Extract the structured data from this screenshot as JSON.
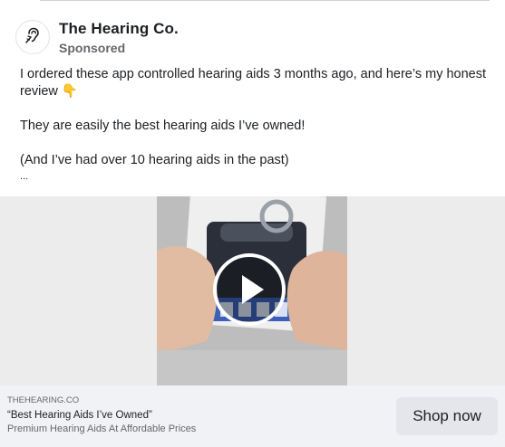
{
  "post": {
    "page_name": "The Hearing Co.",
    "sponsored_label": "Sponsored",
    "text": {
      "line1": "I ordered these app controlled hearing aids 3 months ago, and here’s my honest review 👇",
      "line2": "They are easily the best hearing aids I’ve owned!",
      "line3": "(And I’ve had over 10 hearing aids in the past)",
      "more": "..."
    },
    "avatar_icon": "hearing-ear-icon"
  },
  "media": {
    "type": "video",
    "play_icon": "play-icon"
  },
  "link": {
    "domain": "THEHEARING.CO",
    "title": "“Best Hearing Aids I’ve Owned”",
    "description": "Premium Hearing Aids At Affordable Prices",
    "cta_label": "Shop now"
  },
  "colors": {
    "background": "#ffffff",
    "secondary_text": "#65676b",
    "link_bar": "#f0f2f5",
    "button": "#e4e6eb"
  }
}
